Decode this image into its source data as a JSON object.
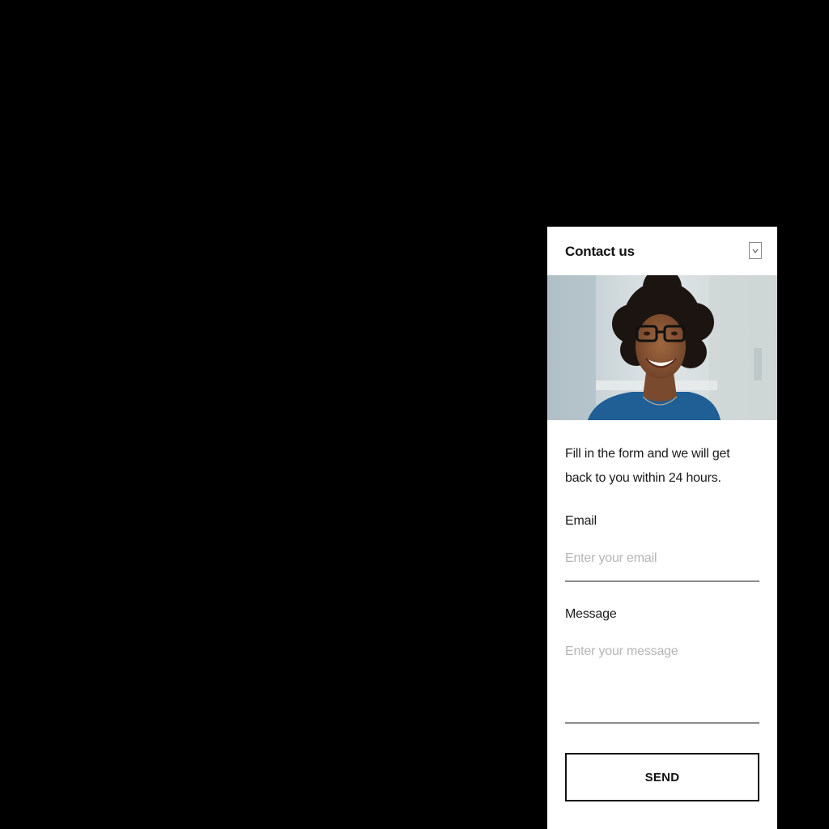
{
  "widget": {
    "title": "Contact us",
    "collapse_icon": "chevron-down-icon",
    "hero_image": "smiling-woman-with-glasses-photo",
    "intro_text": "Fill in the form and we will get back to you within 24 hours.",
    "email": {
      "label": "Email",
      "placeholder": "Enter your email",
      "value": ""
    },
    "message": {
      "label": "Message",
      "placeholder": "Enter your message",
      "value": ""
    },
    "send_label": "SEND"
  },
  "colors": {
    "page_background": "#000000",
    "panel_background": "#ffffff",
    "text": "#1a1a1a",
    "placeholder": "#b5b5b5",
    "underline": "#8c8c8c",
    "shirt": "#1f5f96"
  }
}
